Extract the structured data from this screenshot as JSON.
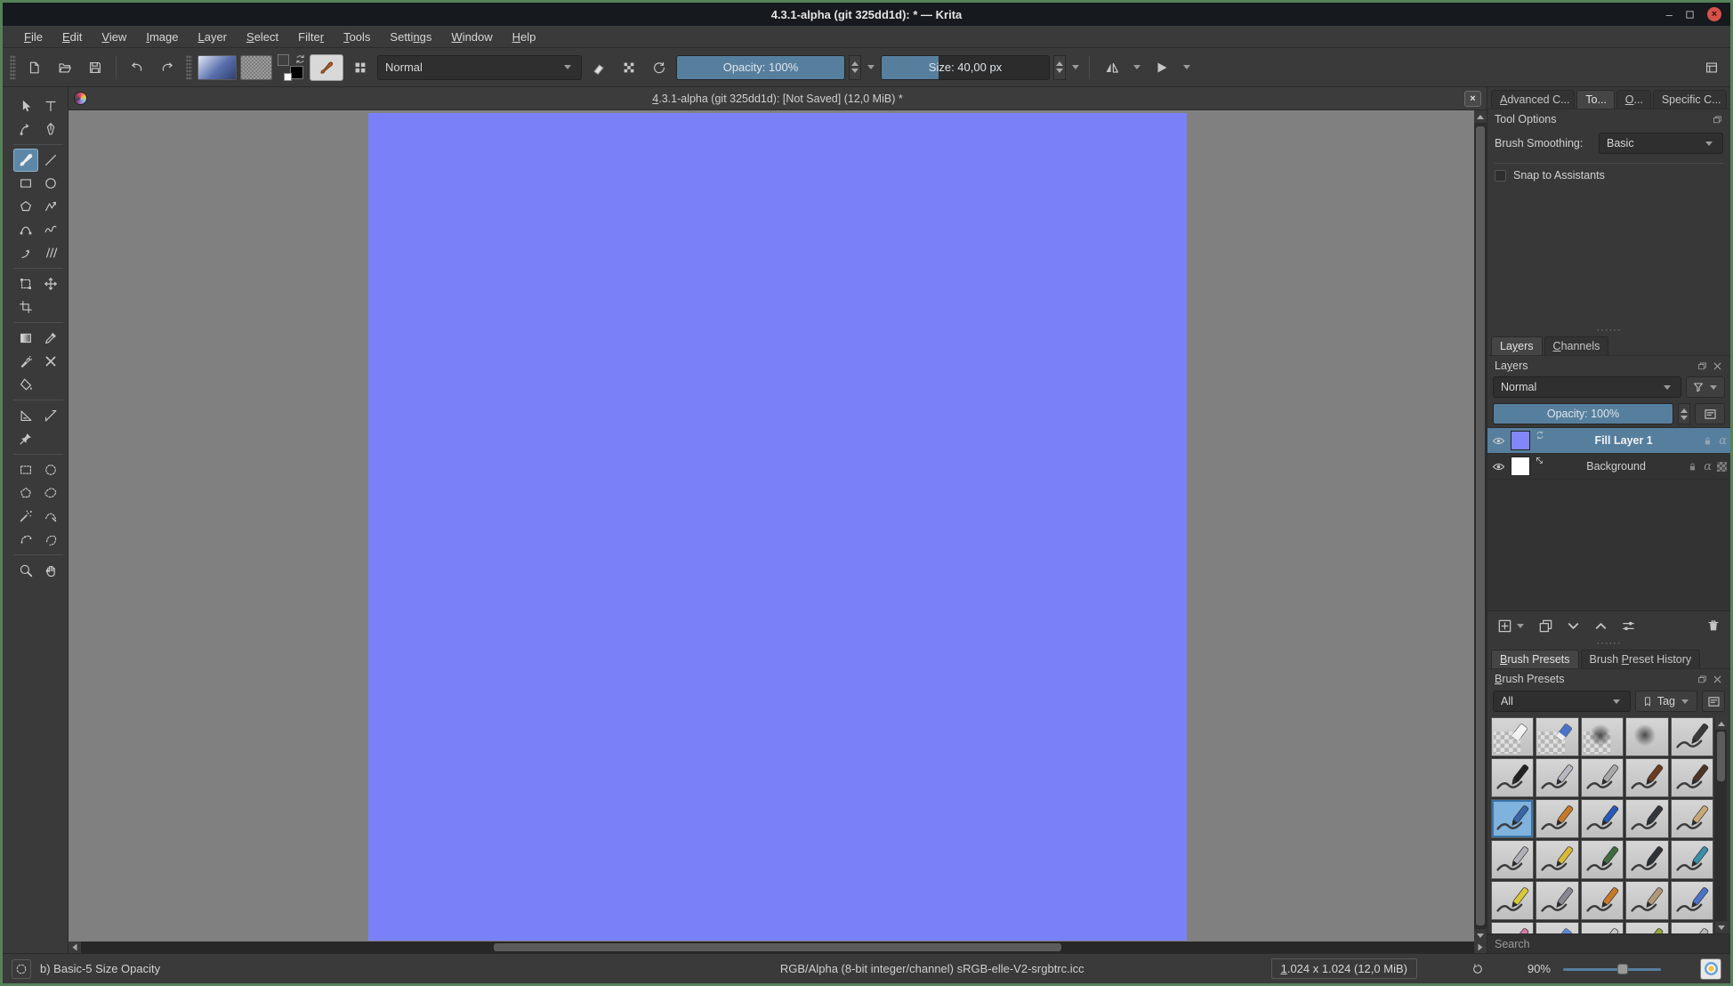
{
  "window": {
    "title": "4.3.1-alpha (git 325dd1d):  * — Krita",
    "minimize": "–",
    "close": "×"
  },
  "menubar": {
    "items": [
      {
        "label": "File",
        "accel": 0
      },
      {
        "label": "Edit",
        "accel": 0
      },
      {
        "label": "View",
        "accel": 0
      },
      {
        "label": "Image",
        "accel": 0
      },
      {
        "label": "Layer",
        "accel": 0
      },
      {
        "label": "Select",
        "accel": 0
      },
      {
        "label": "Filter",
        "accel": 5
      },
      {
        "label": "Tools",
        "accel": 0
      },
      {
        "label": "Settings",
        "accel": 5
      },
      {
        "label": "Window",
        "accel": 0
      },
      {
        "label": "Help",
        "accel": 0
      }
    ]
  },
  "toolbar": {
    "blend_mode": "Normal",
    "opacity_label": "Opacity: 100%",
    "opacity_fill_pct": 100,
    "size_label": "Size: 40,00 px",
    "size_fill_pct": 34
  },
  "toolbox": {
    "selected": "freehand-brush",
    "tools": [
      {
        "name": "pointer"
      },
      {
        "name": "text"
      },
      {
        "name": "edit-shapes"
      },
      {
        "name": "calligraphy"
      },
      {
        "divider": true
      },
      {
        "name": "freehand-brush",
        "selected": true
      },
      {
        "name": "line"
      },
      {
        "name": "rectangle"
      },
      {
        "name": "ellipse"
      },
      {
        "name": "polygon"
      },
      {
        "name": "polyline"
      },
      {
        "name": "bezier-curve"
      },
      {
        "name": "freehand-path"
      },
      {
        "name": "dynamic-brush"
      },
      {
        "name": "multibrush"
      },
      {
        "divider": true
      },
      {
        "name": "transform"
      },
      {
        "name": "move"
      },
      {
        "name": "crop"
      },
      {
        "name": "blank"
      },
      {
        "divider": true
      },
      {
        "name": "gradient"
      },
      {
        "name": "color-picker"
      },
      {
        "name": "colorize-brush"
      },
      {
        "name": "smart-patch"
      },
      {
        "name": "fill"
      },
      {
        "name": "blank"
      },
      {
        "divider": true
      },
      {
        "name": "assistants"
      },
      {
        "name": "measure"
      },
      {
        "name": "reference-images"
      },
      {
        "name": "blank"
      },
      {
        "divider": true
      },
      {
        "name": "rect-select"
      },
      {
        "name": "ellipse-select"
      },
      {
        "name": "poly-select"
      },
      {
        "name": "freehand-select"
      },
      {
        "name": "similar-select"
      },
      {
        "name": "bezier-select"
      },
      {
        "name": "magnetic-select"
      },
      {
        "name": "outline-select"
      },
      {
        "divider": true
      },
      {
        "name": "zoom"
      },
      {
        "name": "pan"
      }
    ]
  },
  "canvas": {
    "tab_title": "4.3.1-alpha (git 325dd1d):  [Not Saved]  (12,0 MiB) *",
    "tab_title_accel": 0,
    "close_label": "×",
    "fill_color": "#7a81f8",
    "workspace_color": "#808080"
  },
  "right_dock": {
    "top_tabs": {
      "active_index": 1,
      "tabs": [
        {
          "label": "Advanced C...",
          "accel": 0
        },
        {
          "label": "To...",
          "accel": -1
        },
        {
          "label": "O...",
          "accel": 0
        },
        {
          "label": "Specific C...",
          "accel": -1
        }
      ]
    },
    "tool_options": {
      "title": "Tool Options",
      "brush_smoothing_label": "Brush Smoothing:",
      "brush_smoothing_value": "Basic",
      "snap_label": "Snap to Assistants",
      "snap_checked": false
    },
    "layers": {
      "tabs": [
        {
          "label": "Layers",
          "accel": 2,
          "active": true
        },
        {
          "label": "Channels",
          "accel": 0
        }
      ],
      "title": "Layers",
      "blend_mode": "Normal",
      "opacity_label": "Opacity:  100%",
      "items": [
        {
          "name": "Fill Layer 1",
          "thumb_color": "#8187f8",
          "selected": true,
          "type": "fill",
          "flags": [
            "lock",
            "alpha"
          ]
        },
        {
          "name": "Background",
          "thumb_color": "#ffffff",
          "selected": false,
          "type": "paint",
          "flags": [
            "lock",
            "alpha",
            "alpha-checker"
          ]
        }
      ]
    },
    "brush_presets": {
      "tabs": [
        {
          "label": "Brush Presets",
          "accel": 0,
          "active": true
        },
        {
          "label": "Brush Preset History",
          "accel": 6
        }
      ],
      "title": "Brush Presets",
      "filter_value": "All",
      "tag_label": "Tag",
      "tag_accel": 2,
      "search_placeholder": "Search",
      "selected_index": 10,
      "grid": [
        {
          "t": "eraser",
          "c": "#f2f2f2"
        },
        {
          "t": "eraser",
          "c": "#4a72c8"
        },
        {
          "t": "airbrush",
          "c": "#9a9a9a"
        },
        {
          "t": "smudge",
          "c": "#555555"
        },
        {
          "t": "pen",
          "c": "#3a3a3a"
        },
        {
          "t": "pen",
          "c": "#222222"
        },
        {
          "t": "pen",
          "c": "#b8b8c0"
        },
        {
          "t": "pen",
          "c": "#a8a8a8"
        },
        {
          "t": "brush",
          "c": "#6b3a1f"
        },
        {
          "t": "brush",
          "c": "#4a3428"
        },
        {
          "t": "brush",
          "c": "#3a66a8"
        },
        {
          "t": "brush",
          "c": "#c87828"
        },
        {
          "t": "pencil",
          "c": "#2858b8"
        },
        {
          "t": "pencil",
          "c": "#33373d"
        },
        {
          "t": "pencil",
          "c": "#c8a878"
        },
        {
          "t": "pen",
          "c": "#b0b0b8"
        },
        {
          "t": "pencil",
          "c": "#d8b838"
        },
        {
          "t": "pencil",
          "c": "#3f6b3f"
        },
        {
          "t": "pen",
          "c": "#2f3338"
        },
        {
          "t": "pen",
          "c": "#3a8ea8"
        },
        {
          "t": "pen",
          "c": "#d8c838"
        },
        {
          "t": "pen",
          "c": "#888890"
        },
        {
          "t": "brush",
          "c": "#c87828"
        },
        {
          "t": "brush",
          "c": "#b09878"
        },
        {
          "t": "pen",
          "c": "#4a72c8"
        },
        {
          "t": "pen",
          "c": "#d878a8"
        },
        {
          "t": "eraser",
          "c": "#5888d8"
        },
        {
          "t": "pen",
          "c": "#c8c8c8"
        },
        {
          "t": "pencil",
          "c": "#98a838"
        },
        {
          "t": "pen",
          "c": "#b8b8b8"
        }
      ]
    }
  },
  "statusbar": {
    "brush_name": "b) Basic-5 Size Opacity",
    "color_info": "RGB/Alpha (8-bit integer/channel)  sRGB-elle-V2-srgbtrc.icc",
    "size_info": "1.024 x 1.024 (12,0 MiB)",
    "size_info_accel": 0,
    "zoom_level": "90%",
    "zoom_slider_pct": 55
  },
  "colors": {
    "accent_blue": "#567f9e",
    "canvas_fill": "#7a81f8",
    "window_border_green": "#55825a",
    "panel_bg": "#3a3a3a"
  }
}
